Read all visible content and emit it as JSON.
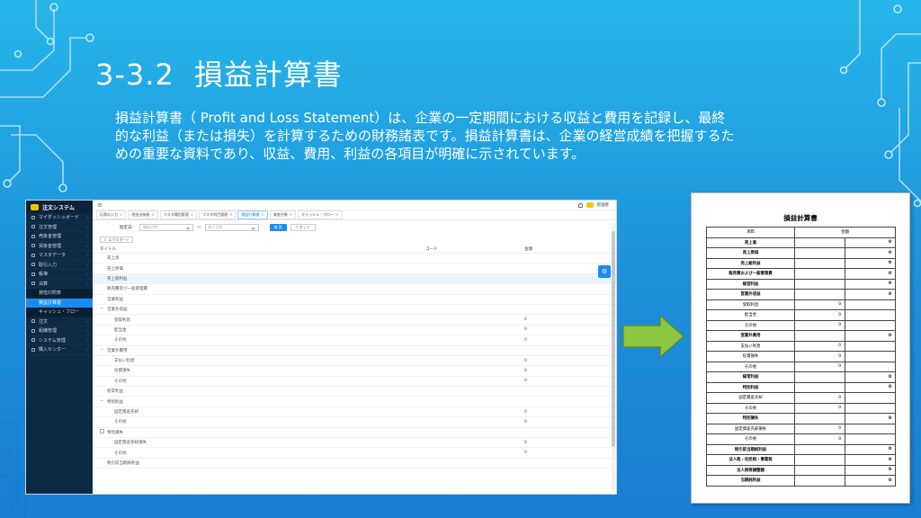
{
  "slide": {
    "number": "3-3.2",
    "title": "損益計算書",
    "description": "損益計算書（ Profit and Loss Statement）は、企業の一定期間における収益と費用を記録し、最終的な利益（または損失）を計算するための財務諸表です。損益計算書は、企業の経営成績を把握するための重要な資料であり、収益、費用、利益の各項目が明確に示されています。"
  },
  "app": {
    "brand": "注文システム",
    "user_name": "管理者",
    "sidebar": [
      {
        "label": "マイダッシュボード",
        "sub": false,
        "active": false
      },
      {
        "label": "注文管理",
        "sub": false,
        "active": false
      },
      {
        "label": "売掛金管理",
        "sub": false,
        "active": false
      },
      {
        "label": "買掛金管理",
        "sub": false,
        "active": false
      },
      {
        "label": "マスタデータ",
        "sub": false,
        "active": false
      },
      {
        "label": "取引入力",
        "sub": false,
        "active": false
      },
      {
        "label": "帳簿",
        "sub": false,
        "active": false
      },
      {
        "label": "決算",
        "sub": false,
        "active": false
      },
      {
        "label": "貸借対照表",
        "sub": true,
        "active": false
      },
      {
        "label": "損益計算書",
        "sub": true,
        "active": true
      },
      {
        "label": "キャッシュ・フロー",
        "sub": true,
        "active": false
      },
      {
        "label": "注文",
        "sub": false,
        "active": false
      },
      {
        "label": "組織管理",
        "sub": false,
        "active": false
      },
      {
        "label": "システム管理",
        "sub": false,
        "active": false
      },
      {
        "label": "購入センター",
        "sub": false,
        "active": false
      }
    ],
    "tabs": [
      {
        "label": "伝票の入力",
        "active": false
      },
      {
        "label": "現金出納帳",
        "active": false
      },
      {
        "label": "マスタ種別管理",
        "active": false
      },
      {
        "label": "マスタ科目管理",
        "active": false
      },
      {
        "label": "損益計算書",
        "active": true
      },
      {
        "label": "資産台帳",
        "active": false
      },
      {
        "label": "キャッシュ・フロー",
        "active": false
      }
    ],
    "filter": {
      "label": "勘定日：",
      "start_placeholder": "開始日時",
      "separator": "～",
      "end_placeholder": "終了日時",
      "search_label": "検 索",
      "reset_label": "リセット"
    },
    "export_label": "エクスポート",
    "columns": {
      "title": "タイトル",
      "code": "コード",
      "amount": "金額"
    },
    "rows": [
      {
        "title": "売上高",
        "amount": "",
        "indent": 1,
        "check": false,
        "exp": false,
        "hl": false
      },
      {
        "title": "売上原価",
        "amount": "",
        "indent": 1,
        "check": false,
        "exp": false,
        "hl": false
      },
      {
        "title": "売上総利益",
        "amount": "",
        "indent": 1,
        "check": false,
        "exp": false,
        "hl": true
      },
      {
        "title": "販売費及び一般管理費",
        "amount": "",
        "indent": 1,
        "check": false,
        "exp": false,
        "hl": false
      },
      {
        "title": "営業利益",
        "amount": "",
        "indent": 1,
        "check": false,
        "exp": false,
        "hl": false
      },
      {
        "title": "営業外収益",
        "amount": "",
        "indent": 1,
        "check": false,
        "exp": true,
        "hl": false
      },
      {
        "title": "受取利息",
        "amount": "0",
        "indent": 2,
        "check": false,
        "exp": false,
        "hl": false
      },
      {
        "title": "配当金",
        "amount": "0",
        "indent": 2,
        "check": false,
        "exp": false,
        "hl": false
      },
      {
        "title": "その他",
        "amount": "0",
        "indent": 2,
        "check": false,
        "exp": false,
        "hl": false
      },
      {
        "title": "営業外費用",
        "amount": "",
        "indent": 1,
        "check": false,
        "exp": true,
        "hl": false
      },
      {
        "title": "支払い利息",
        "amount": "0",
        "indent": 2,
        "check": false,
        "exp": false,
        "hl": false
      },
      {
        "title": "投資損失",
        "amount": "0",
        "indent": 2,
        "check": false,
        "exp": false,
        "hl": false
      },
      {
        "title": "その他",
        "amount": "0",
        "indent": 2,
        "check": false,
        "exp": false,
        "hl": false
      },
      {
        "title": "経常利益",
        "amount": "",
        "indent": 1,
        "check": false,
        "exp": false,
        "hl": false
      },
      {
        "title": "特別利益",
        "amount": "",
        "indent": 1,
        "check": false,
        "exp": true,
        "hl": false
      },
      {
        "title": "固定資産売却",
        "amount": "0",
        "indent": 2,
        "check": false,
        "exp": false,
        "hl": false
      },
      {
        "title": "その他",
        "amount": "0",
        "indent": 2,
        "check": false,
        "exp": false,
        "hl": false
      },
      {
        "title": "特別損失",
        "amount": "",
        "indent": 1,
        "check": true,
        "exp": false,
        "hl": false
      },
      {
        "title": "固定資産売却損失",
        "amount": "0",
        "indent": 2,
        "check": false,
        "exp": false,
        "hl": false
      },
      {
        "title": "その他",
        "amount": "0",
        "indent": 2,
        "check": false,
        "exp": false,
        "hl": false
      },
      {
        "title": "税引前当期純利益",
        "amount": "",
        "indent": 1,
        "check": false,
        "exp": false,
        "hl": false
      }
    ]
  },
  "statement": {
    "title": "損益計算書",
    "headers": [
      "項目",
      "金額"
    ],
    "rows": [
      {
        "label": "売上高",
        "mid": "",
        "right": "0",
        "bold": true
      },
      {
        "label": "売上原価",
        "mid": "",
        "right": "0",
        "bold": true
      },
      {
        "label": "売上総利益",
        "mid": "",
        "right": "0",
        "bold": true
      },
      {
        "label": "販売費および一般管理費",
        "mid": "",
        "right": "0",
        "bold": true
      },
      {
        "label": "経営利益",
        "mid": "",
        "right": "0",
        "bold": true
      },
      {
        "label": "営業外収益",
        "mid": "",
        "right": "0",
        "bold": true
      },
      {
        "label": "受取利息",
        "mid": "0",
        "right": "",
        "bold": false
      },
      {
        "label": "配当金",
        "mid": "0",
        "right": "",
        "bold": false
      },
      {
        "label": "その他",
        "mid": "0",
        "right": "",
        "bold": false
      },
      {
        "label": "営業外費用",
        "mid": "",
        "right": "0",
        "bold": true
      },
      {
        "label": "支払い利息",
        "mid": "0",
        "right": "",
        "bold": false
      },
      {
        "label": "投資損失",
        "mid": "0",
        "right": "",
        "bold": false
      },
      {
        "label": "その他",
        "mid": "0",
        "right": "",
        "bold": false
      },
      {
        "label": "経常利益",
        "mid": "",
        "right": "0",
        "bold": true
      },
      {
        "label": "特別利益",
        "mid": "",
        "right": "0",
        "bold": true
      },
      {
        "label": "固定資産売却",
        "mid": "0",
        "right": "",
        "bold": false
      },
      {
        "label": "その他",
        "mid": "0",
        "right": "",
        "bold": false
      },
      {
        "label": "特別損失",
        "mid": "",
        "right": "0",
        "bold": true
      },
      {
        "label": "固定資産売却損失",
        "mid": "0",
        "right": "",
        "bold": false
      },
      {
        "label": "その他",
        "mid": "0",
        "right": "",
        "bold": false
      },
      {
        "label": "税引前当期純利益",
        "mid": "",
        "right": "0",
        "bold": true
      },
      {
        "label": "法人税・住民税・事業税",
        "mid": "",
        "right": "0",
        "bold": true
      },
      {
        "label": "法人税等調整額",
        "mid": "",
        "right": "0",
        "bold": true
      },
      {
        "label": "当期純利益",
        "mid": "",
        "right": "0",
        "bold": true
      }
    ]
  },
  "colors": {
    "accent": "#1a8cf0",
    "sidebar": "#0f2a44",
    "arrow": "#8dc63f"
  }
}
